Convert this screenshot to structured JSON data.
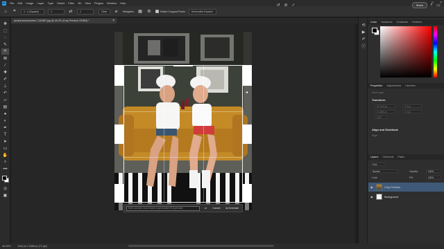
{
  "menu": {
    "logo": "Ps",
    "items": [
      "File",
      "Edit",
      "Image",
      "Layer",
      "Type",
      "Select",
      "Filter",
      "3D",
      "View",
      "Plugins",
      "Window",
      "Help"
    ]
  },
  "options": {
    "ratio": "1 : 1 (Square)",
    "w_value": "1",
    "h_value": "1",
    "clear": "Clear",
    "straighten": "Straighten",
    "delete_cropped": "Delete Cropped Pixels",
    "fill_mode": "Generative Expand",
    "share": "Share"
  },
  "document": {
    "tab_title": "pexels-koolshooters-7142987.jpg @ 46.3% (Crop Preview, RGB/8) *",
    "close": "×"
  },
  "genfill": {
    "placeholder": "Enter prompt, leave blank to generative fill (optional)",
    "more": "•••",
    "cancel": "Cancel",
    "generate": "Generate"
  },
  "status": {
    "zoom": "46.33%",
    "dims": "1444 px x 1668 px (72 ppi)"
  },
  "panels": {
    "color_tabs": [
      "Color",
      "Swatches",
      "Gradients",
      "Patterns"
    ],
    "props_tabs": [
      "Properties",
      "Adjustments",
      "Libraries"
    ],
    "pixel_layer": "Pixel Layer",
    "transform_title": "Transform",
    "transform_fields": [
      "W 1444 px",
      "H 1668 px",
      "X 0 px",
      "Y 0 px",
      "0.00°"
    ],
    "align_title": "Align and Distribute",
    "align_label": "Align:",
    "layers_tabs": [
      "Layers",
      "Channels",
      "Paths"
    ],
    "kind": "Kind",
    "blend": "Normal",
    "opacity_label": "Opacity:",
    "opacity": "100%",
    "lock_label": "Lock:",
    "fill_label": "Fill:",
    "fill": "100%",
    "layers": [
      {
        "name": "Crop Preview",
        "selected": true
      },
      {
        "name": "Background",
        "selected": false
      }
    ]
  },
  "colors": {
    "accent": "#2fa3f7",
    "selected_layer": "#3f5a78"
  }
}
